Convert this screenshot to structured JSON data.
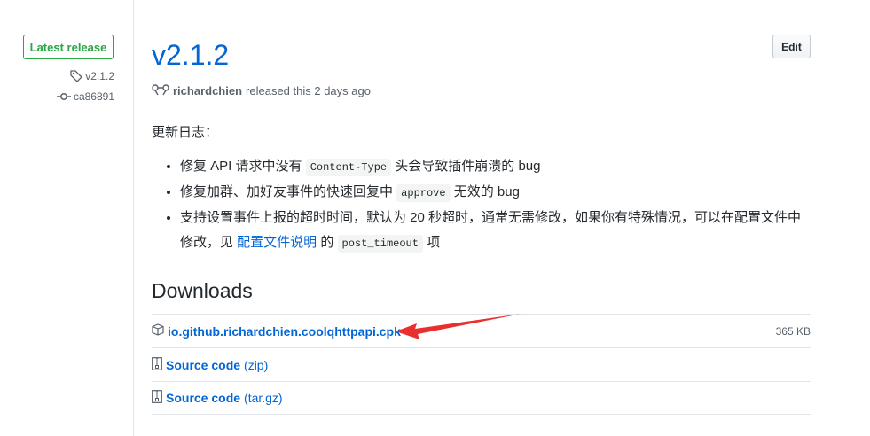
{
  "sidebar": {
    "badge": "Latest release",
    "tag": "v2.1.2",
    "commit": "ca86891"
  },
  "release": {
    "title": "v2.1.2",
    "author": "richardchien",
    "released_text": "released this 2 days ago",
    "edit_label": "Edit"
  },
  "notes": {
    "heading": "更新日志：",
    "items": [
      {
        "before": "修复 API 请求中没有 ",
        "code": "Content-Type",
        "after": " 头会导致插件崩溃的 bug"
      },
      {
        "before": "修复加群、加好友事件的快速回复中 ",
        "code": "approve",
        "after": " 无效的 bug"
      },
      {
        "before": "支持设置事件上报的超时时间，默认为 20 秒超时，通常无需修改，如果你有特殊情况，可以在配置文件中修改，见 ",
        "link": "配置文件说明",
        "middle": " 的 ",
        "code": "post_timeout",
        "after": " 项"
      }
    ]
  },
  "downloads": {
    "heading": "Downloads",
    "files": [
      {
        "name": "io.github.richardchien.coolqhttpapi.cpk",
        "ext": "",
        "size": "365 KB",
        "icon": "package-icon"
      },
      {
        "name": "Source code",
        "ext": "(zip)",
        "size": "",
        "icon": "file-zip-icon"
      },
      {
        "name": "Source code",
        "ext": "(tar.gz)",
        "size": "",
        "icon": "file-zip-icon"
      }
    ]
  },
  "colors": {
    "link": "#0366d6",
    "badge_green": "#28a745",
    "arrow_red": "#e8302f"
  }
}
